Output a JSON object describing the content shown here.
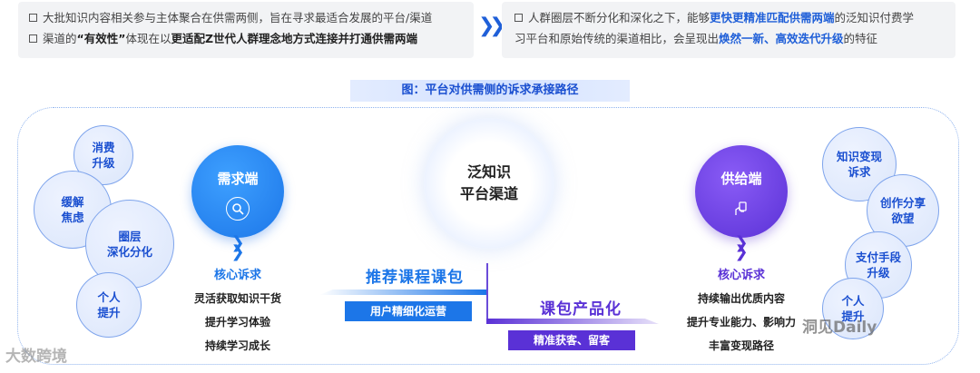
{
  "summary": {
    "left_line1": "大批知识内容相关参与主体聚合在供需两侧，旨在寻求最适合发展的平台/渠道",
    "left_line2_prefix": "渠道的",
    "left_line2_bold1": "“有效性”",
    "left_line2_mid": "体现在以",
    "left_line2_bold2": "更适配Z世代人群理念地方式连接并打通供需两端",
    "right_line1_prefix": "人群圈层不断分化和深化之下，能够",
    "right_line1_blue": "更快更精准匹配供需两端",
    "right_line1_suffix": "的泛知识付费学",
    "right_line2_prefix": "习平台和原始传统的渠道相比，会呈现出",
    "right_line2_blue": "焕然一新、高效迭代升级",
    "right_line2_suffix": "的特征"
  },
  "caption": "图：平台对供需侧的诉求承接路径",
  "left_bubbles": [
    "消费\n升级",
    "缓解\n焦虑",
    "圈层\n深化分化",
    "个人\n提升"
  ],
  "right_bubbles": [
    "知识变现\n诉求",
    "创作分享\n欲望",
    "支付手段\n升级",
    "个人\n提升"
  ],
  "demand": {
    "title": "需求端",
    "core_title": "核心诉求",
    "items": [
      "灵活获取知识干货",
      "提升学习体验",
      "持续学习成长"
    ]
  },
  "supply": {
    "title": "供给端",
    "core_title": "核心诉求",
    "items": [
      "持续输出优质内容",
      "提升专业能力、影响力",
      "丰富变现路径"
    ]
  },
  "center": {
    "title": "泛知识\n平台渠道"
  },
  "paths": {
    "recommend": "推荐课程课包",
    "recommend_tag": "用户精细化运营",
    "package": "课包产品化",
    "package_tag": "精准获客、留客"
  },
  "watermarks": {
    "left": "大数跨境",
    "right": "洞见Daily"
  },
  "colors": {
    "demand": "#1c76e8",
    "supply": "#5a31d6",
    "accent": "#1f5fd8"
  }
}
